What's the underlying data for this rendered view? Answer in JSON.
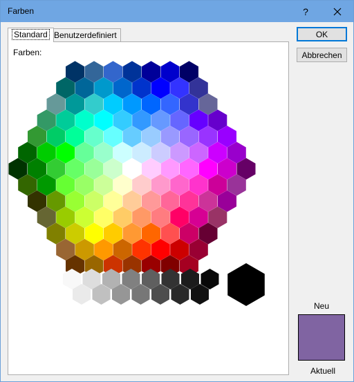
{
  "window": {
    "title": "Farben"
  },
  "titlebar": {
    "help_glyph": "?",
    "close_icon": "close-icon"
  },
  "tabs": [
    {
      "label": "Standard",
      "active": true
    },
    {
      "label": "Benutzerdefiniert",
      "active": false
    }
  ],
  "panel": {
    "colors_label": "Farben:"
  },
  "buttons": {
    "ok": "OK",
    "cancel": "Abbrechen"
  },
  "preview": {
    "new_label": "Neu",
    "current_label": "Aktuell",
    "color": "#8064a2"
  },
  "selected_color": "#000000",
  "palette_rows": [
    [
      "#003366",
      "#336699",
      "#3366cc",
      "#003399",
      "#000099",
      "#0000cc",
      "#000066"
    ],
    [
      "#006666",
      "#006699",
      "#0099cc",
      "#0066cc",
      "#0033cc",
      "#0000ff",
      "#3333ff",
      "#333399"
    ],
    [
      "#669999",
      "#009999",
      "#33cccc",
      "#00ccff",
      "#0099ff",
      "#0066ff",
      "#3366ff",
      "#3333cc",
      "#666699"
    ],
    [
      "#339966",
      "#00cc99",
      "#00ffcc",
      "#00ffff",
      "#33ccff",
      "#3399ff",
      "#6699ff",
      "#6666ff",
      "#6600ff",
      "#6600cc"
    ],
    [
      "#339933",
      "#00cc66",
      "#00ff99",
      "#66ffcc",
      "#66ffff",
      "#66ccff",
      "#99ccff",
      "#9999ff",
      "#9966ff",
      "#9933ff",
      "#9900ff"
    ],
    [
      "#006600",
      "#00cc00",
      "#00ff00",
      "#66ff99",
      "#99ffcc",
      "#ccffff",
      "#ccecff",
      "#ccccff",
      "#cc99ff",
      "#cc66ff",
      "#cc00ff",
      "#9900cc"
    ],
    [
      "#003300",
      "#008000",
      "#33cc33",
      "#66ff66",
      "#99ff99",
      "#ccffcc",
      "#ffffff",
      "#ffccff",
      "#ff99ff",
      "#ff66ff",
      "#ff00ff",
      "#cc00cc",
      "#660066"
    ],
    [
      "#336600",
      "#009900",
      "#66ff33",
      "#99ff66",
      "#ccff99",
      "#ffffcc",
      "#ffcccc",
      "#ff99cc",
      "#ff66cc",
      "#ff33cc",
      "#cc0099",
      "#993399"
    ],
    [
      "#333300",
      "#669900",
      "#99ff33",
      "#ccff66",
      "#ffff99",
      "#ffcc99",
      "#ff9999",
      "#ff6699",
      "#ff3399",
      "#cc3399",
      "#990099"
    ],
    [
      "#666633",
      "#99cc00",
      "#ccff33",
      "#ffff66",
      "#ffcc66",
      "#ff9966",
      "#ff7c80",
      "#ff0066",
      "#d60093",
      "#993366"
    ],
    [
      "#808000",
      "#cccc00",
      "#ffff00",
      "#ffcc00",
      "#ff9933",
      "#ff6600",
      "#ff5050",
      "#cc0066",
      "#660033"
    ],
    [
      "#996633",
      "#cc9900",
      "#ff9900",
      "#cc6600",
      "#ff3300",
      "#ff0000",
      "#cc0000",
      "#990033"
    ],
    [
      "#663300",
      "#996600",
      "#cc3300",
      "#993300",
      "#990000",
      "#800000",
      "#a50021"
    ]
  ],
  "gray_rows": [
    [
      "#f8f8f8",
      "#dddddd",
      "#b2b2b2",
      "#808080",
      "#5f5f5f",
      "#333333",
      "#1c1c1c",
      "#080808"
    ],
    [
      "#eaeaea",
      "#c0c0c0",
      "#969696",
      "#777777",
      "#4d4d4d",
      "#292929",
      "#111111"
    ]
  ]
}
